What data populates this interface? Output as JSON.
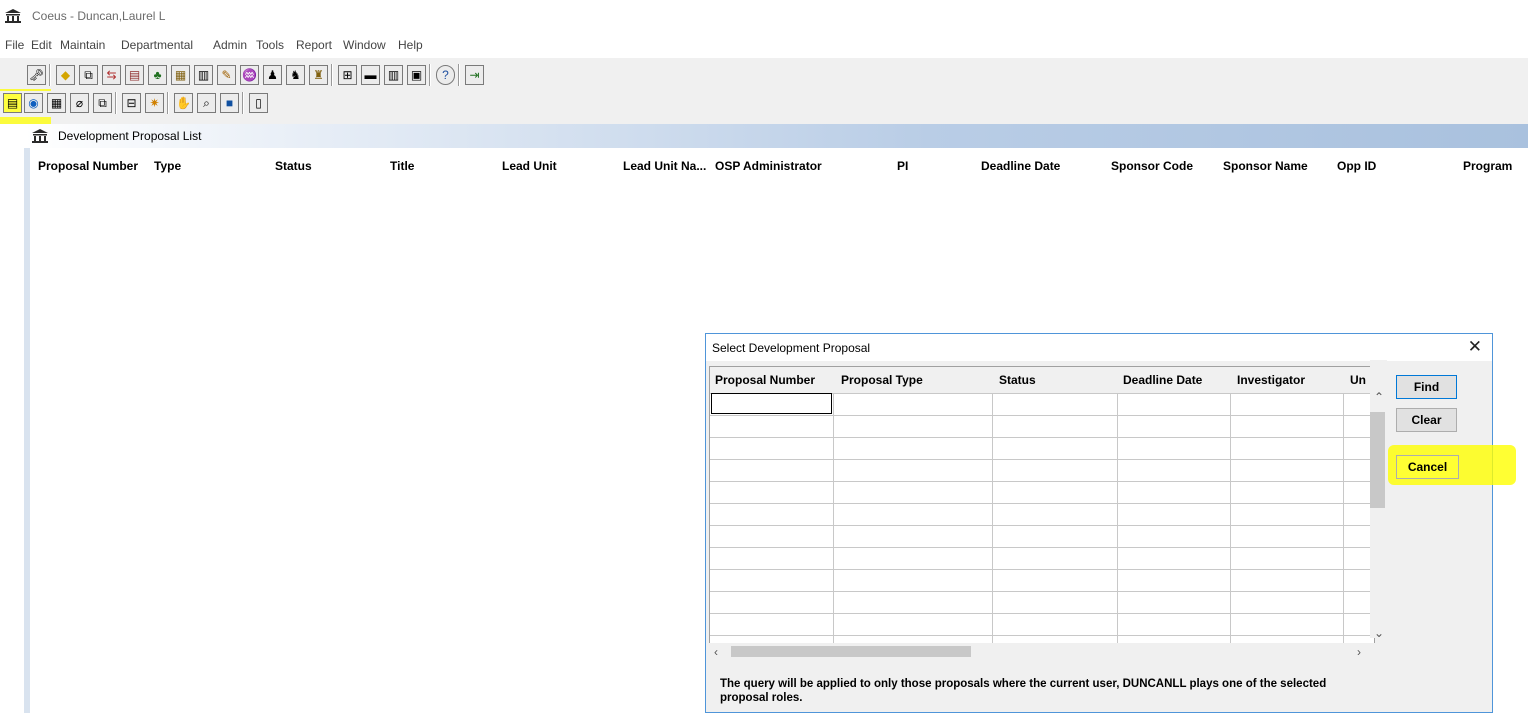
{
  "window": {
    "title": "Coeus -  Duncan,Laurel L",
    "app_icon": "building-icon"
  },
  "menu": [
    "File",
    "Edit",
    "Maintain",
    "Departmental",
    "Admin",
    "Tools",
    "Report",
    "Window",
    "Help"
  ],
  "toolbar1": [
    "🗝",
    "◆",
    "⧉",
    "⇆",
    "▤",
    "♣",
    "▦",
    "▥",
    "✎",
    "♒",
    "♟",
    "♞",
    "♜",
    "⊞",
    "▬",
    "▥",
    "▣",
    "?",
    "⇥"
  ],
  "toolbar2": [
    "▤",
    "◉",
    "▦",
    "⌀",
    "⧉",
    "⊟",
    "✷",
    "✋",
    "⌕",
    "■",
    "▯"
  ],
  "list": {
    "title": "Development Proposal List",
    "columns": [
      "Proposal Number",
      "Type",
      "Status",
      "Title",
      "Lead Unit",
      "Lead Unit Na...",
      "OSP Administrator",
      "PI",
      "Deadline Date",
      "Sponsor Code",
      "Sponsor Name",
      "Opp ID",
      "Program"
    ]
  },
  "dialog": {
    "title": "Select Development Proposal",
    "close_glyph": "✕",
    "columns": [
      "Proposal Number",
      "Proposal Type",
      "Status",
      "Deadline Date",
      "Investigator",
      "Un"
    ],
    "buttons": {
      "find": "Find",
      "clear": "Clear",
      "cancel": "Cancel"
    },
    "notice": "The query will be applied to only those proposals where the current user, DUNCANLL plays one of the selected proposal roles."
  },
  "highlight_color": "#ffff00"
}
